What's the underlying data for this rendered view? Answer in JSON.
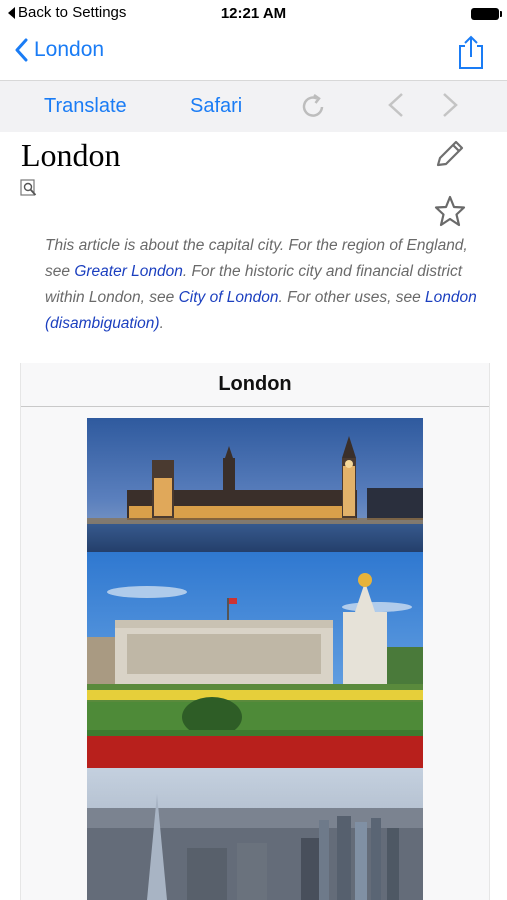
{
  "status_bar": {
    "back_label": "Back to Settings",
    "time": "12:21 AM"
  },
  "nav": {
    "back_label": "London"
  },
  "toolbar": {
    "translate_label": "Translate",
    "safari_label": "Safari"
  },
  "article": {
    "title": "London",
    "hatnote": {
      "t1": "This article is about the capital city. For the region of England, see ",
      "link1": "Greater London",
      "t2": ". For the historic city and financial district within London, see ",
      "link2": "City of London",
      "t3": ". For other uses, see ",
      "link3": "London (disambiguation)",
      "t4": "."
    }
  },
  "infobox": {
    "title": "London"
  },
  "colors": {
    "accent": "#1a7cf5",
    "link": "#1b3fbf",
    "toolbar_bg": "#f2f2f4"
  }
}
